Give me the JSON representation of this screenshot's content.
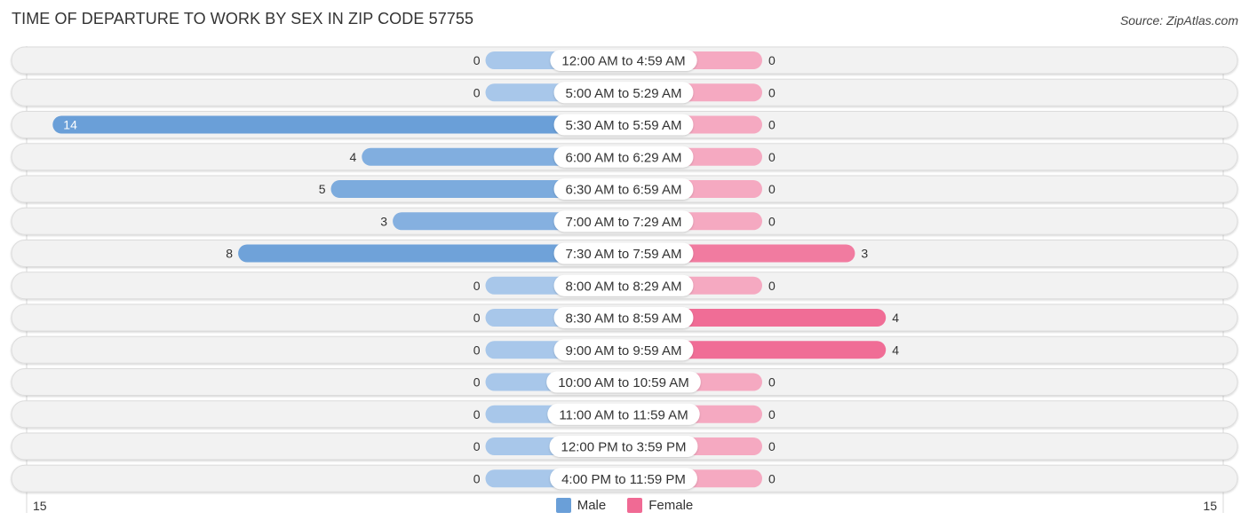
{
  "title": "TIME OF DEPARTURE TO WORK BY SEX IN ZIP CODE 57755",
  "source": "Source: ZipAtlas.com",
  "colors": {
    "male": "#6a9fd8",
    "male_light": "#a8c7ea",
    "female": "#f06a94",
    "female_light": "#f5a9c1",
    "row_bg": "#f2f2f2",
    "label_bg": "#ffffff"
  },
  "chart_data": {
    "type": "bar",
    "orientation": "horizontal-diverging",
    "title": "TIME OF DEPARTURE TO WORK BY SEX IN ZIP CODE 57755",
    "categories": [
      "12:00 AM to 4:59 AM",
      "5:00 AM to 5:29 AM",
      "5:30 AM to 5:59 AM",
      "6:00 AM to 6:29 AM",
      "6:30 AM to 6:59 AM",
      "7:00 AM to 7:29 AM",
      "7:30 AM to 7:59 AM",
      "8:00 AM to 8:29 AM",
      "8:30 AM to 8:59 AM",
      "9:00 AM to 9:59 AM",
      "10:00 AM to 10:59 AM",
      "11:00 AM to 11:59 AM",
      "12:00 PM to 3:59 PM",
      "4:00 PM to 11:59 PM"
    ],
    "series": [
      {
        "name": "Male",
        "values": [
          0,
          0,
          14,
          4,
          5,
          3,
          8,
          0,
          0,
          0,
          0,
          0,
          0,
          0
        ]
      },
      {
        "name": "Female",
        "values": [
          0,
          0,
          0,
          0,
          0,
          0,
          3,
          0,
          4,
          4,
          0,
          0,
          0,
          0
        ]
      }
    ],
    "axis": {
      "min_label": "15",
      "max_label": "15",
      "range": [
        -15,
        15
      ]
    },
    "legend": {
      "position": "bottom-center",
      "entries": [
        "Male",
        "Female"
      ]
    }
  }
}
